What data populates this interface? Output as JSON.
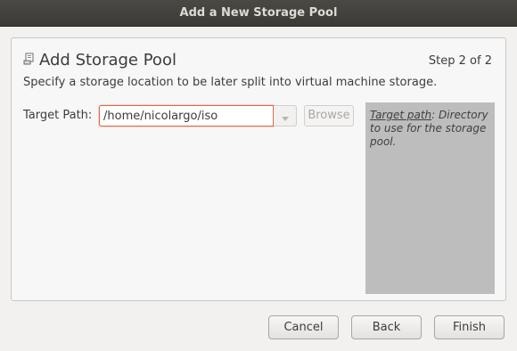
{
  "window": {
    "title": "Add a New Storage Pool"
  },
  "header": {
    "icon": "storage-pool-icon",
    "title": "Add Storage Pool",
    "step": "Step 2 of 2",
    "subtitle": "Specify a storage location to be later split into virtual machine storage."
  },
  "form": {
    "target_path_label": "Target Path:",
    "target_path_value": "/home/nicolargo/iso",
    "browse_label": "Browse"
  },
  "help": {
    "term": "Target path",
    "text": ": Directory to use for the storage pool."
  },
  "buttons": {
    "cancel": "Cancel",
    "back": "Back",
    "finish": "Finish"
  },
  "colors": {
    "accent_focus": "#e06a4b",
    "titlebar": "#3c3b37",
    "help_bg": "#bdbdbd"
  }
}
